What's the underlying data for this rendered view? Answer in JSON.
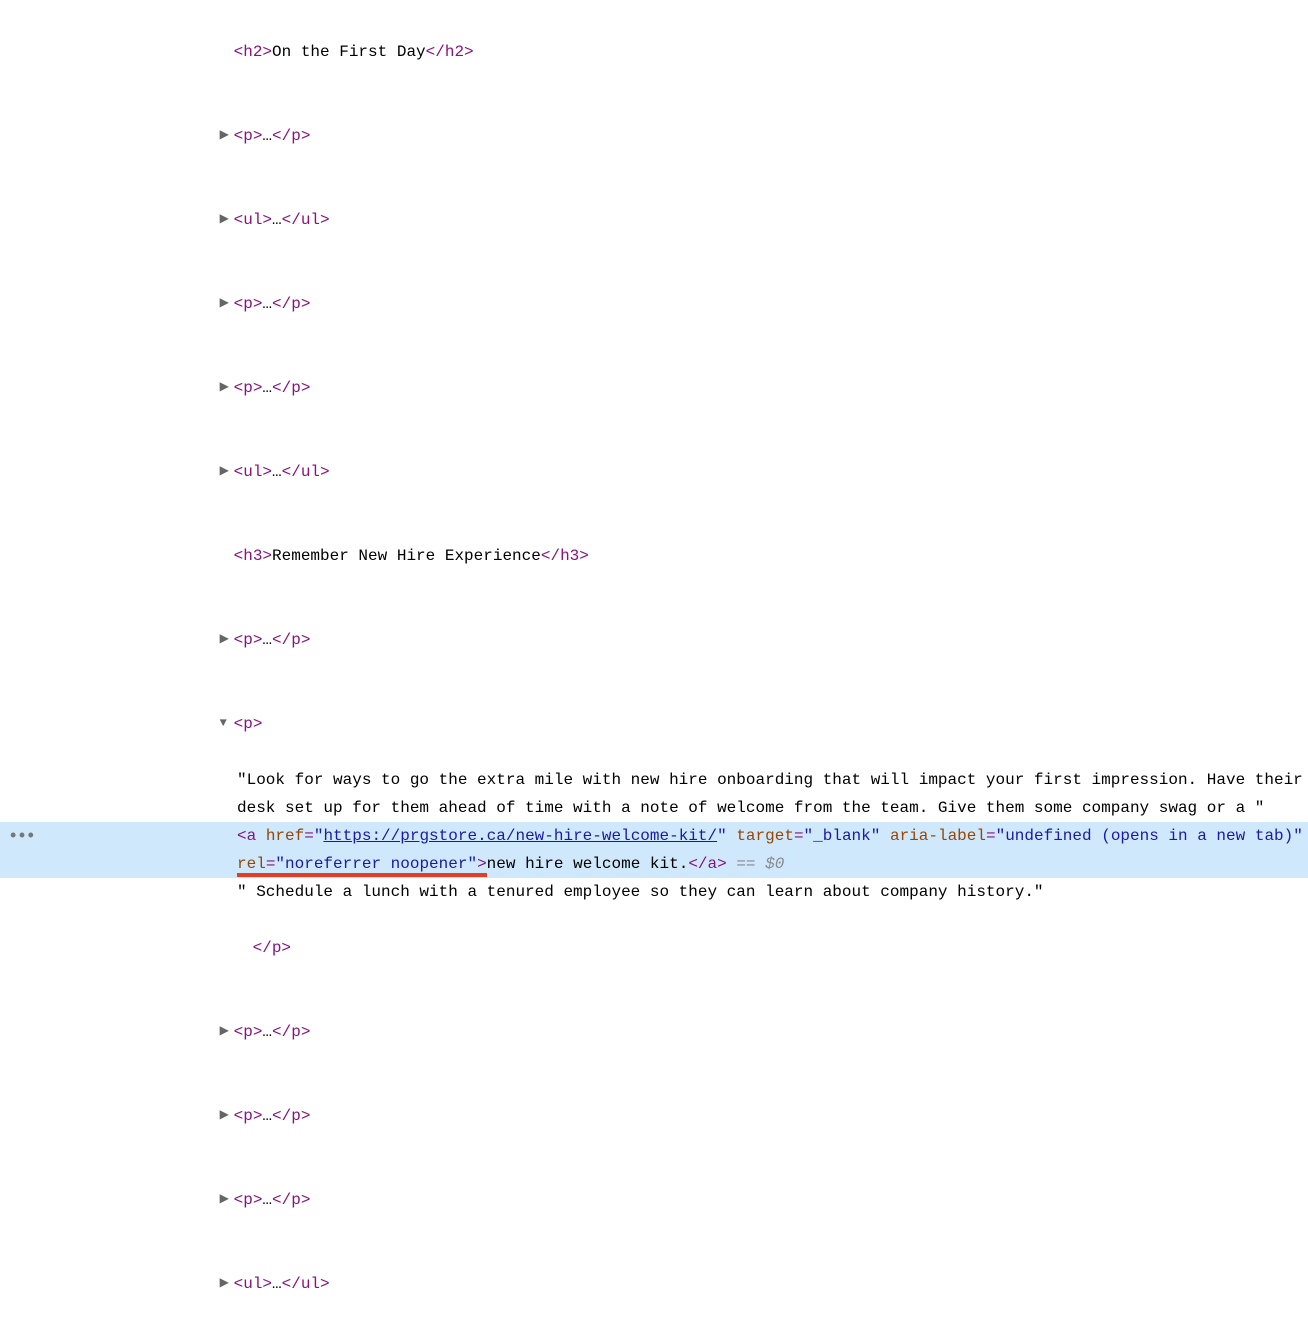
{
  "gutterDots": "•••",
  "rows": {
    "h2_open": "<h2>",
    "h2_text": "On the First Day",
    "h2_close": "</h2>",
    "p_open": "<p>",
    "p_close": "</p>",
    "ul_open": "<ul>",
    "ul_close": "</ul>",
    "h3_open": "<h3>",
    "h3_text": "Remember New Hire Experience",
    "h3_close": "</h3>",
    "dots": "…"
  },
  "para": {
    "text1": "\"Look for ways to go the extra mile with new hire onboarding that will impact your first impression. Have their desk set up for them ahead of time with a note of welcome from the team. Give them some company swag or a \"",
    "text2": "\" Schedule a lunch with a tenured employee so they can learn about company history.\""
  },
  "anchor": {
    "open_a": "<a",
    "href_name": "href",
    "href_val_q": "\"",
    "href_val": "https://prgstore.ca/new-hire-welcome-kit/",
    "target_name": "target",
    "target_val": "\"_blank\"",
    "aria_name": "aria-label",
    "aria_eq": "=",
    "aria_val": "\"undefined (opens in a new tab)\"",
    "rel_name": "rel",
    "rel_eq": "=",
    "rel_val": "\"noreferrer noopener\"",
    "gt": ">",
    "link_text": "new hire welcome kit.",
    "close_a": "</a>",
    "eq0": " == $0"
  },
  "close_p": "</p>"
}
